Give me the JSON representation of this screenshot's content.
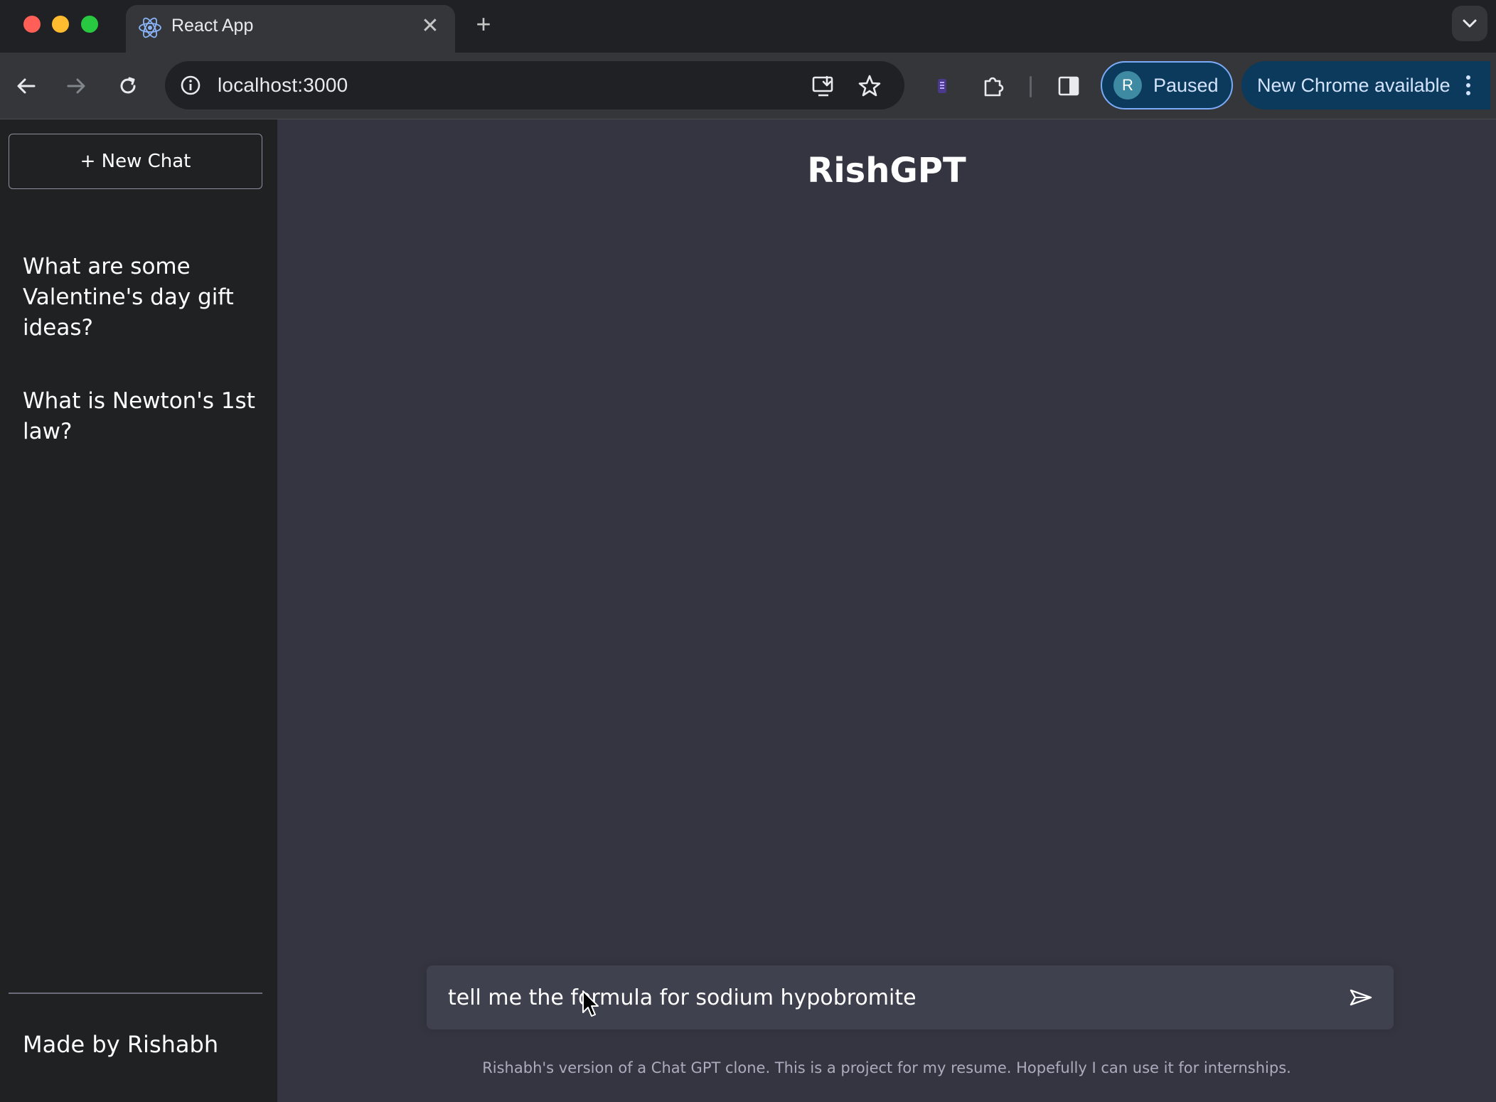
{
  "browser": {
    "tab": {
      "title": "React App",
      "favicon": "react-logo-icon",
      "close_icon": "close-icon"
    },
    "new_tab_icon": "plus-icon",
    "tab_search_icon": "chevron-down-icon",
    "toolbar": {
      "back_icon": "arrow-left-icon",
      "forward_icon": "arrow-right-icon",
      "reload_icon": "reload-icon",
      "site_info_icon": "info-icon",
      "url": "localhost:3000",
      "install_icon": "install-app-icon",
      "bookmark_icon": "star-icon",
      "extension_icons": [
        "extension-app-icon",
        "puzzle-icon"
      ],
      "side_panel_icon": "side-panel-icon",
      "profile": {
        "initial": "R",
        "label": "Paused"
      },
      "update": {
        "label": "New Chrome available",
        "menu_icon": "kebab-menu-icon"
      }
    }
  },
  "sidebar": {
    "new_chat_label": "+ New Chat",
    "history": [
      {
        "title": "What are some Valentine's day gift ideas?"
      },
      {
        "title": "What is Newton's 1st law?"
      }
    ],
    "footer": "Made by Rishabh"
  },
  "main": {
    "title": "RishGPT",
    "input": {
      "value": "tell me the formula for sodium hypobromite"
    },
    "send_icon": "send-arrow-icon",
    "footnote": "Rishabh's version of a Chat GPT clone. This is a project for my resume. Hopefully I can use it for internships."
  },
  "colors": {
    "sidebar_bg": "#202123",
    "main_bg": "#343541",
    "input_bg": "#40414f",
    "profile_pill": "#0c3a5c"
  }
}
